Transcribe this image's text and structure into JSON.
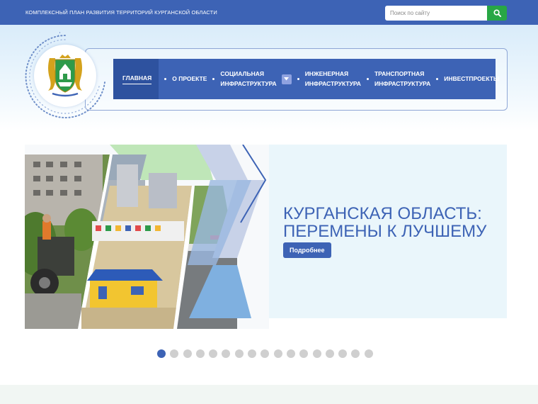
{
  "topbar": {
    "site_title": "КОМПЛЕКСНЫЙ ПЛАН РАЗВИТИЯ ТЕРРИТОРИЙ КУРГАНСКОЙ ОБЛАСТИ",
    "search_placeholder": "Поиск по сайту",
    "search_icon": "search-icon"
  },
  "nav": {
    "items": [
      {
        "label": "ГЛАВНАЯ",
        "active": true
      },
      {
        "label": "О ПРОЕКТЕ"
      },
      {
        "line1": "СОЦИАЛЬНАЯ",
        "line2": "ИНФРАСТРУКТУРА",
        "has_dropdown": true
      },
      {
        "line1": "ИНЖЕНЕРНАЯ",
        "line2": "ИНФРАСТРУКТУРА"
      },
      {
        "line1": "ТРАНСПОРТНАЯ",
        "line2": "ИНФРАСТРУКТУРА"
      },
      {
        "label": "ИНВЕСТПРОЕКТЫ"
      }
    ]
  },
  "hero": {
    "title_line1": "КУРГАНСКАЯ ОБЛАСТЬ:",
    "title_line2": "ПЕРЕМЕНЫ К ЛУЧШЕМУ",
    "button_label": "Подробнее"
  },
  "slider": {
    "total_slides": 17,
    "active_slide": 1
  },
  "colors": {
    "brand_blue": "#3d63b5",
    "nav_active": "#2e529f",
    "search_green": "#28a745",
    "dot_inactive": "#cfcfcf"
  }
}
